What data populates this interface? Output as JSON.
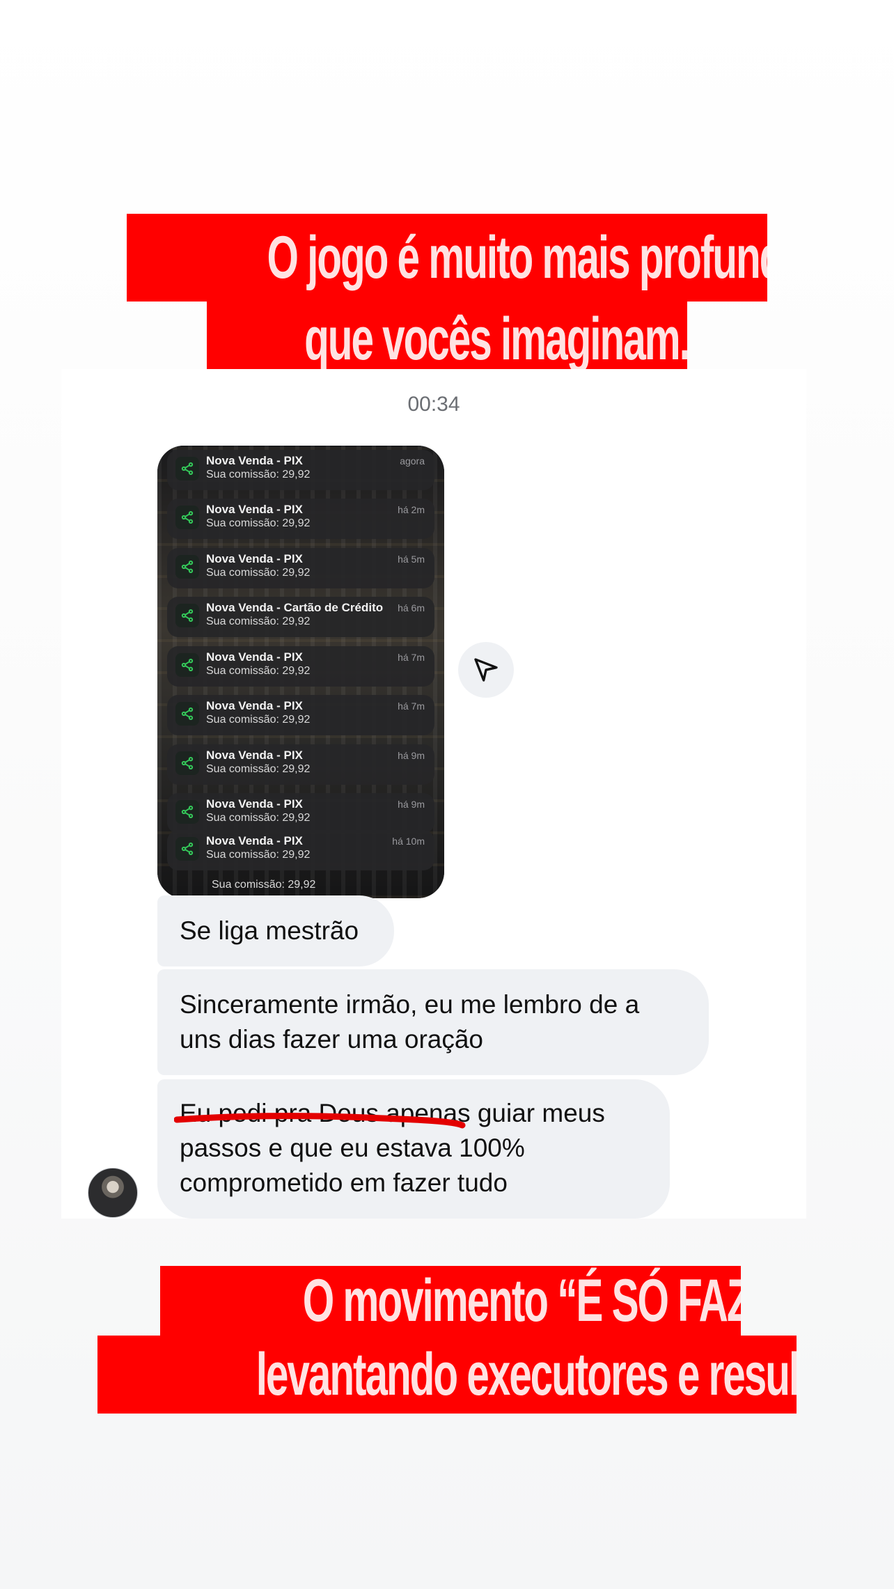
{
  "banners": {
    "top": {
      "line1": "O jogo é muito mais profundo do",
      "line2": "que vocês imaginam...."
    },
    "bottom": {
      "line1": "O movimento “É SÓ FAZER” está",
      "line2": "levantando executores e resultados..."
    }
  },
  "chat": {
    "timestamp": "00:34",
    "screenshot": {
      "notifications": [
        {
          "title": "Nova Venda - PIX",
          "body": "Sua comissão: 29,92",
          "time": "agora"
        },
        {
          "title": "Nova Venda - PIX",
          "body": "Sua comissão: 29,92",
          "time": "há 2m"
        },
        {
          "title": "Nova Venda - PIX",
          "body": "Sua comissão: 29,92",
          "time": "há 5m"
        },
        {
          "title": "Nova Venda - Cartão de Crédito",
          "body": "Sua comissão: 29,92",
          "time": "há 6m"
        },
        {
          "title": "Nova Venda - PIX",
          "body": "Sua comissão: 29,92",
          "time": "há 7m"
        },
        {
          "title": "Nova Venda - PIX",
          "body": "Sua comissão: 29,92",
          "time": "há 7m"
        },
        {
          "title": "Nova Venda - PIX",
          "body": "Sua comissão: 29,92",
          "time": "há 9m"
        },
        {
          "title": "Nova Venda - PIX",
          "body": "Sua comissão: 29,92",
          "time": "há 9m"
        },
        {
          "title": "Nova Venda - PIX",
          "body": "Sua comissão: 29,92",
          "time": "há 10m"
        }
      ],
      "tail_text": "Sua comissão: 29,92"
    },
    "messages": [
      {
        "lines": [
          "Se liga mestrão"
        ]
      },
      {
        "lines": [
          "Sinceramente irmão, eu me lembro de a",
          "uns dias fazer uma oração"
        ]
      },
      {
        "lines": [
          "Eu pedi pra Deus apenas guiar meus",
          "passos e que eu estava 100%",
          "comprometido em fazer tudo"
        ]
      }
    ],
    "icons": {
      "share": "paper-plane-icon",
      "notification": "share-node-icon"
    },
    "colors": {
      "banner": "#ff0000",
      "banner_text": "#ffe2e2",
      "bubble": "#eff1f4",
      "underline": "#e30000",
      "notif_icon": "#34c759"
    }
  }
}
